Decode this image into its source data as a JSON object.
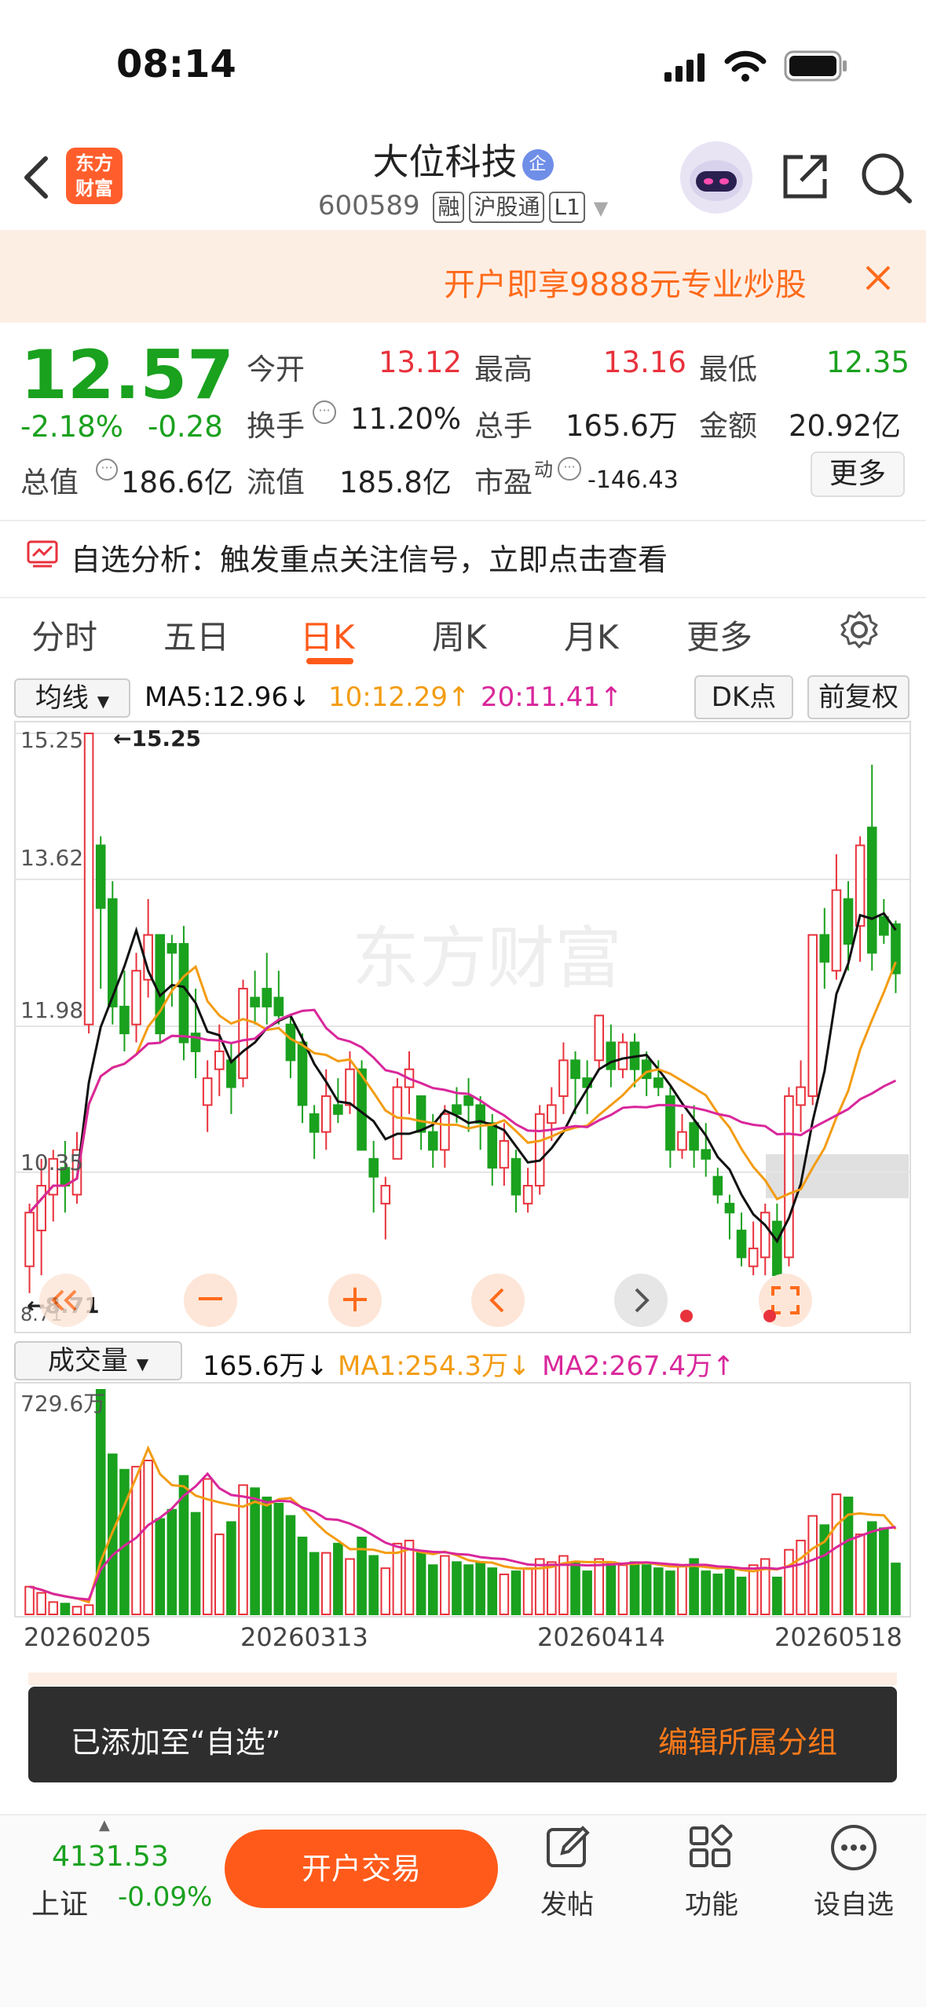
{
  "status": {
    "time": "08:14"
  },
  "header": {
    "logo_line1": "东方",
    "logo_line2": "财富",
    "stock_name": "大位科技",
    "verified_badge": "企",
    "code": "600589",
    "tags": [
      "融",
      "沪股通",
      "L1"
    ]
  },
  "banner": {
    "text": "开户即享9888元专业炒股"
  },
  "quote": {
    "price": "12.57",
    "change_pct": "-2.18%",
    "change": "-0.28",
    "open_label": "今开",
    "open": "13.12",
    "high_label": "最高",
    "high": "13.16",
    "low_label": "最低",
    "low": "12.35",
    "turnover_label": "换手",
    "turnover": "11.20%",
    "volume_label": "总手",
    "volume": "165.6万",
    "amount_label": "金额",
    "amount": "20.92亿",
    "mktcap_label": "总值",
    "mktcap": "186.6亿",
    "float_label": "流值",
    "float": "185.8亿",
    "pe_label": "市盈",
    "pe_sup": "动",
    "pe": "-146.43",
    "more": "更多"
  },
  "analysis": {
    "text": "自选分析：触发重点关注信号，立即点击查看"
  },
  "tabs": [
    "分时",
    "五日",
    "日K",
    "周K",
    "月K",
    "更多"
  ],
  "chart_controls": {
    "ma_select": "均线",
    "ma5": "MA5:12.96↓",
    "ma10": "10:12.29↑",
    "ma20": "20:11.41↑",
    "dk": "DK点",
    "adjust": "前复权",
    "y_labels": [
      "15.25",
      "13.62",
      "11.98",
      "10.35",
      "8.71"
    ],
    "max_label": "←15.25",
    "min_label": "←8.71",
    "vol_select": "成交量",
    "vol_value": "165.6万↓",
    "vol_ma1": "MA1:254.3万↓",
    "vol_ma2": "MA2:267.4万↑",
    "vol_ymax": "729.6万",
    "dates": [
      "20260205",
      "20260313",
      "20260414",
      "20260518"
    ],
    "watermark": "东方财富"
  },
  "colors": {
    "up": "#e8323c",
    "down": "#1aa11e",
    "ma5": "#111111",
    "ma10": "#f39c12",
    "ma20": "#d9279b",
    "accent": "#ff5a1a"
  },
  "chart_data": {
    "type": "candlestick",
    "ylim": [
      8.71,
      15.25
    ],
    "candles": [
      [
        9.3,
        9.9,
        9.0,
        10.0
      ],
      [
        9.7,
        10.2,
        9.2,
        10.5
      ],
      [
        10.1,
        10.5,
        9.8,
        10.6
      ],
      [
        10.4,
        10.2,
        9.9,
        10.7
      ],
      [
        10.1,
        10.6,
        10.0,
        10.8
      ],
      [
        12.0,
        15.25,
        11.9,
        15.25
      ],
      [
        14.0,
        13.3,
        12.4,
        14.1
      ],
      [
        13.4,
        12.2,
        12.0,
        13.6
      ],
      [
        12.2,
        11.9,
        11.7,
        12.6
      ],
      [
        12.0,
        12.6,
        11.8,
        12.8
      ],
      [
        12.5,
        13.0,
        12.3,
        13.4
      ],
      [
        13.0,
        11.9,
        11.8,
        13.0
      ],
      [
        12.9,
        12.8,
        12.2,
        13.0
      ],
      [
        12.9,
        11.8,
        11.6,
        13.1
      ],
      [
        11.9,
        11.7,
        11.4,
        12.4
      ],
      [
        11.1,
        11.4,
        10.8,
        11.6
      ],
      [
        11.5,
        11.7,
        11.2,
        12.0
      ],
      [
        11.6,
        11.3,
        11.0,
        11.8
      ],
      [
        11.4,
        12.4,
        11.3,
        12.5
      ],
      [
        12.3,
        12.2,
        12.0,
        12.6
      ],
      [
        12.4,
        12.2,
        12.0,
        12.8
      ],
      [
        12.3,
        12.1,
        12.0,
        12.6
      ],
      [
        12.0,
        11.6,
        11.4,
        12.1
      ],
      [
        11.8,
        11.1,
        10.9,
        11.9
      ],
      [
        11.0,
        10.8,
        10.5,
        11.1
      ],
      [
        10.8,
        11.2,
        10.6,
        11.5
      ],
      [
        11.1,
        11.0,
        10.9,
        11.4
      ],
      [
        11.1,
        11.5,
        11.0,
        11.7
      ],
      [
        11.5,
        10.6,
        10.6,
        11.6
      ],
      [
        10.5,
        10.3,
        9.9,
        10.7
      ],
      [
        10.0,
        10.2,
        9.6,
        10.3
      ],
      [
        10.5,
        11.3,
        10.5,
        11.4
      ],
      [
        11.3,
        11.5,
        11.0,
        11.7
      ],
      [
        11.2,
        10.8,
        10.6,
        11.2
      ],
      [
        10.8,
        10.6,
        10.4,
        11.0
      ],
      [
        10.6,
        11.0,
        10.4,
        11.1
      ],
      [
        11.1,
        11.0,
        10.9,
        11.3
      ],
      [
        11.2,
        11.1,
        10.8,
        11.4
      ],
      [
        11.1,
        10.9,
        10.6,
        11.2
      ],
      [
        10.9,
        10.4,
        10.2,
        11.0
      ],
      [
        10.4,
        10.7,
        10.2,
        10.9
      ],
      [
        10.5,
        10.1,
        9.9,
        10.6
      ],
      [
        10.0,
        10.2,
        9.9,
        10.4
      ],
      [
        10.2,
        11.0,
        10.1,
        11.1
      ],
      [
        10.9,
        11.1,
        10.7,
        11.3
      ],
      [
        11.2,
        11.6,
        11.0,
        11.8
      ],
      [
        11.6,
        11.4,
        11.0,
        11.7
      ],
      [
        11.4,
        11.3,
        11.0,
        11.6
      ],
      [
        11.6,
        12.1,
        11.5,
        12.1
      ],
      [
        11.8,
        11.5,
        11.3,
        12.0
      ],
      [
        11.5,
        11.8,
        11.4,
        11.9
      ],
      [
        11.8,
        11.5,
        11.3,
        11.9
      ],
      [
        11.6,
        11.4,
        11.2,
        11.7
      ],
      [
        11.4,
        11.3,
        11.2,
        11.6
      ],
      [
        11.2,
        10.6,
        10.4,
        11.3
      ],
      [
        10.6,
        10.8,
        10.5,
        11.0
      ],
      [
        10.9,
        10.6,
        10.4,
        11.1
      ],
      [
        10.6,
        10.5,
        10.3,
        10.9
      ],
      [
        10.3,
        10.1,
        10.0,
        10.4
      ],
      [
        10.0,
        9.9,
        9.6,
        10.1
      ],
      [
        9.7,
        9.4,
        9.3,
        9.9
      ],
      [
        9.3,
        9.5,
        9.2,
        9.8
      ],
      [
        9.4,
        9.9,
        9.2,
        10.0
      ],
      [
        9.8,
        9.2,
        9.2,
        10.0
      ],
      [
        9.4,
        11.2,
        9.3,
        11.3
      ],
      [
        11.1,
        11.3,
        10.8,
        11.6
      ],
      [
        11.2,
        13.0,
        11.1,
        13.0
      ],
      [
        13.0,
        12.7,
        12.4,
        13.3
      ],
      [
        12.6,
        13.5,
        12.5,
        13.9
      ],
      [
        13.4,
        12.9,
        12.6,
        13.6
      ],
      [
        13.1,
        14.0,
        12.7,
        14.1
      ],
      [
        14.2,
        12.8,
        12.6,
        14.9
      ],
      [
        13.2,
        13.0,
        12.9,
        13.4
      ],
      [
        13.12,
        12.57,
        12.35,
        13.16
      ]
    ],
    "volume": [
      90,
      70,
      40,
      35,
      25,
      30,
      729.6,
      520,
      470,
      480,
      500,
      310,
      340,
      450,
      330,
      440,
      260,
      300,
      420,
      410,
      380,
      360,
      320,
      250,
      200,
      200,
      230,
      180,
      250,
      190,
      150,
      230,
      240,
      200,
      160,
      190,
      170,
      160,
      170,
      150,
      130,
      140,
      150,
      180,
      170,
      190,
      170,
      140,
      180,
      170,
      160,
      170,
      160,
      150,
      140,
      160,
      180,
      140,
      130,
      150,
      120,
      160,
      180,
      120,
      210,
      240,
      320,
      290,
      390,
      380,
      260,
      300,
      280,
      165.6
    ],
    "ma5_value": 12.96,
    "ma10_value": 12.29,
    "ma20_value": 11.41
  },
  "toast": {
    "message": "已添加至“自选”",
    "action": "编辑所属分组"
  },
  "bottom": {
    "index_value": "4131.53",
    "index_name": "上证",
    "index_change": "-0.09%",
    "trade": "开户交易",
    "post": "发帖",
    "func": "功能",
    "watch": "设自选"
  }
}
